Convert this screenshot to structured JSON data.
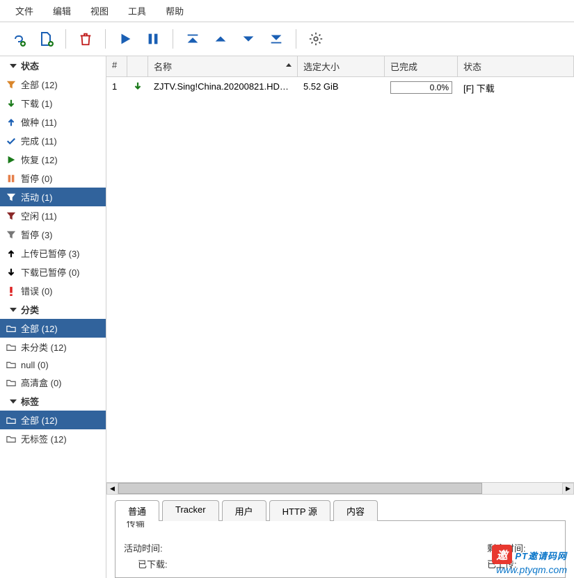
{
  "menu": {
    "file": "文件",
    "edit": "编辑",
    "view": "视图",
    "tools": "工具",
    "help": "帮助"
  },
  "sidebar": {
    "status_header": "状态",
    "status": [
      {
        "label": "全部 (12)",
        "icon": "filter",
        "color": "#d9862b"
      },
      {
        "label": "下载 (1)",
        "icon": "arrow-down",
        "color": "#1a7a1a"
      },
      {
        "label": "做种 (11)",
        "icon": "arrow-up",
        "color": "#1a5fb4"
      },
      {
        "label": "完成 (11)",
        "icon": "check",
        "color": "#1a5fb4"
      },
      {
        "label": "恢复 (12)",
        "icon": "play",
        "color": "#1a7a1a"
      },
      {
        "label": "暂停 (0)",
        "icon": "pause",
        "color": "#e57f4a"
      },
      {
        "label": "活动 (1)",
        "icon": "filter",
        "color": "#1a7a1a",
        "selected": true
      },
      {
        "label": "空闲 (11)",
        "icon": "filter",
        "color": "#8a2828"
      },
      {
        "label": "暂停 (3)",
        "icon": "filter",
        "color": "#777"
      },
      {
        "label": "上传已暂停 (3)",
        "icon": "arrow-up",
        "color": "#000"
      },
      {
        "label": "下载已暂停 (0)",
        "icon": "arrow-down",
        "color": "#000"
      },
      {
        "label": "错误 (0)",
        "icon": "error",
        "color": "#d22"
      }
    ],
    "category_header": "分类",
    "categories": [
      {
        "label": "全部 (12)",
        "selected": true
      },
      {
        "label": "未分类 (12)"
      },
      {
        "label": "null (0)"
      },
      {
        "label": "高清盒 (0)"
      }
    ],
    "tag_header": "标签",
    "tags": [
      {
        "label": "全部 (12)",
        "selected": true
      },
      {
        "label": "无标签 (12)"
      }
    ]
  },
  "columns": {
    "num": "#",
    "name": "名称",
    "size": "选定大小",
    "done": "已完成",
    "status": "状态"
  },
  "rows": [
    {
      "num": "1",
      "name": "ZJTV.Sing!China.20200821.HDTV...",
      "size": "5.52 GiB",
      "done": "0.0%",
      "status": "[F] 下载"
    }
  ],
  "tabs": {
    "general": "普通",
    "tracker": "Tracker",
    "user": "用户",
    "http": "HTTP 源",
    "content": "内容"
  },
  "panel": {
    "section": "传输",
    "active_time_label": "活动时间:",
    "active_time_value": "",
    "remaining_label": "剩余时间:",
    "downloaded_label": "已下载:",
    "uploaded_label": "已上传:"
  },
  "watermark": {
    "badge": "邀",
    "title": "PT邀请码网",
    "url": "www.ptyqm.com"
  }
}
